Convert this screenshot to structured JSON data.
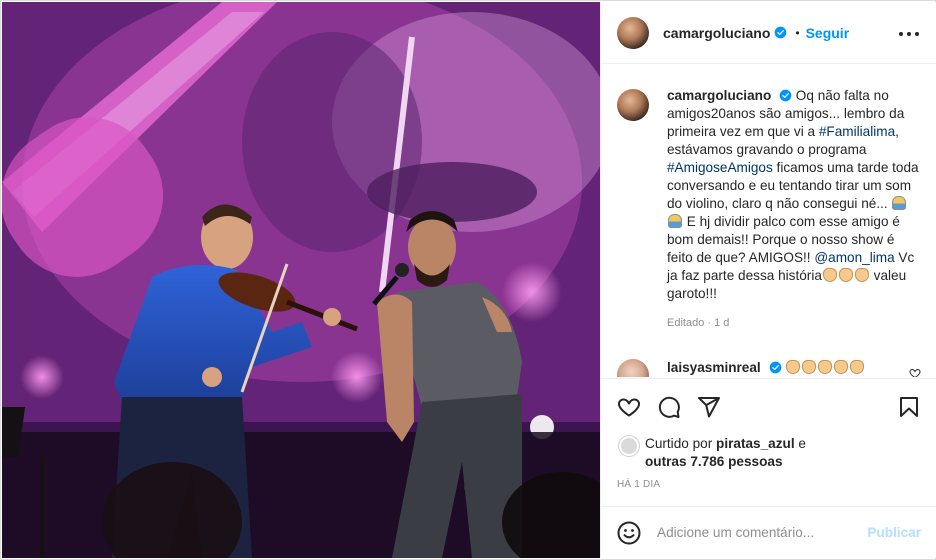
{
  "post": {
    "username": "camargoluciano",
    "follow_label": "Seguir",
    "header_dot": "•",
    "caption": {
      "username": "camargoluciano",
      "part1": " Oq não falta no amigos20anos são amigos... lembro da primeira vez em que vi a ",
      "tag1": "#Familialima",
      "part2": ", estávamos gravando o programa ",
      "tag2": "#AmigoseAmigos",
      "part3": " ficamos uma tarde toda conversando e eu tentando tirar um som do violino, claro q não consegui né... ",
      "part4": " E hj dividir palco com esse amigo é bom demais!! Porque o nosso show é feito de que? AMIGOS!! ",
      "mention": "@amon_lima",
      "part5": " Vc ja faz parte dessa história",
      "part6": " valeu garoto!!!"
    },
    "caption_meta": "Editado · 1 d",
    "comment2": {
      "username": "laisyasminreal"
    },
    "liked_by_prefix": "Curtido por",
    "liked_by_user": "piratas_azul",
    "liked_by_and": "e",
    "others_count": "outras 7.786 pessoas",
    "time_ago": "HÁ 1 DIA",
    "comment_placeholder": "Adicione um comentário...",
    "publish_label": "Publicar"
  },
  "icons": {
    "verified": "verified-badge-icon",
    "more": "more-options-icon",
    "heart": "heart-icon",
    "comment": "comment-icon",
    "share": "share-icon",
    "save": "bookmark-icon",
    "emoji": "emoji-icon"
  },
  "colors": {
    "accent": "#0095f6",
    "link": "#00376b",
    "muted": "#8e8e8e",
    "disabled_publish": "#b2dffc",
    "border": "#dbdbdb"
  }
}
